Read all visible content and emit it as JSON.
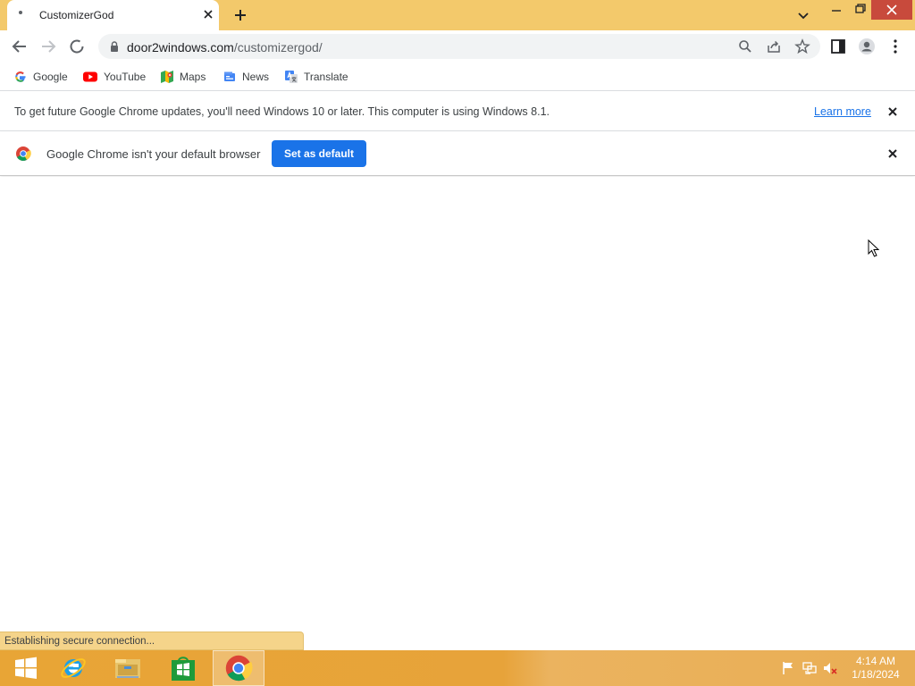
{
  "window": {
    "tab_title": "CustomizerGod",
    "theme_color": "#f3c96b"
  },
  "toolbar": {
    "url_host": "door2windows.com",
    "url_path": "/customizergod/"
  },
  "bookmarks": [
    {
      "label": "Google",
      "icon": "google-icon"
    },
    {
      "label": "YouTube",
      "icon": "youtube-icon"
    },
    {
      "label": "Maps",
      "icon": "maps-icon"
    },
    {
      "label": "News",
      "icon": "news-icon"
    },
    {
      "label": "Translate",
      "icon": "translate-icon"
    }
  ],
  "infobar_update": {
    "message": "To get future Google Chrome updates, you'll need Windows 10 or later. This computer is using Windows 8.1.",
    "link": "Learn more"
  },
  "infobar_default": {
    "message": "Google Chrome isn't your default browser",
    "button": "Set as default"
  },
  "status": {
    "text": "Establishing secure connection..."
  },
  "taskbar": {
    "apps": [
      "windows-start",
      "internet-explorer",
      "file-explorer",
      "windows-store",
      "google-chrome"
    ],
    "time": "4:14 AM",
    "date": "1/18/2024",
    "accent_color": "#e8a536"
  }
}
